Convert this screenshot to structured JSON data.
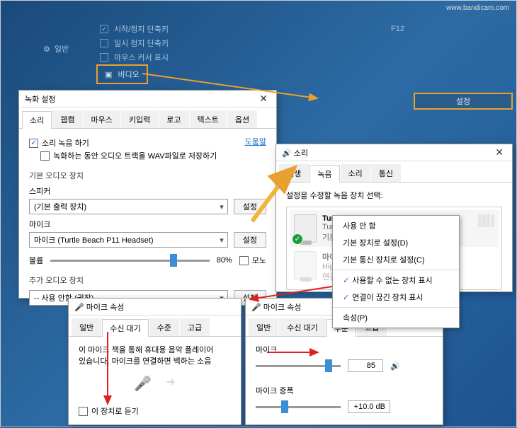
{
  "watermark": "www.bandicam.com",
  "bg": {
    "rows": [
      "시작/정지 단축키",
      "일시 정지 단축키",
      "마우스 커서 표시"
    ],
    "f12": "F12",
    "nav_general": "일반",
    "nav_video": "비디오",
    "setbtn": "설정"
  },
  "rec": {
    "title": "녹화 설정",
    "tabs": [
      "소리",
      "웹캠",
      "마우스",
      "키입력",
      "로고",
      "텍스트",
      "옵션"
    ],
    "opt1": "소리 녹음 하기",
    "opt2": "녹화하는 동안 오디오 트랙을 WAV파일로 저장하기",
    "help": "도움말",
    "group1": "기본 오디오 장치",
    "speaker_label": "스피커",
    "speaker_val": "(기본 출력 장치)",
    "mic_label": "마이크",
    "mic_val": "마이크 (Turtle Beach P11 Headset)",
    "btn_set": "설정",
    "volume": "볼륨",
    "volume_pct": "80%",
    "mono": "모노",
    "group2": "추가 오디오 장치",
    "extra_val": "-- 사용 안함 (권장) --"
  },
  "snd": {
    "title": "소리",
    "tabs": [
      "재생",
      "녹음",
      "소리",
      "통신"
    ],
    "desc": "설정을 수정할 녹음 장치 선택:",
    "dev1_name": "Turtle Beach P11",
    "dev1_line": "Turtle B",
    "dev1_sub": "기본 장",
    "dev2_name": "마이크",
    "dev2_line": "High D",
    "dev2_sub": "연결되"
  },
  "menu": {
    "items": [
      "사용 안 함",
      "기본 장치로 설정(D)",
      "기본 통신 장치로 설정(C)",
      "사용할 수 없는 장치 표시",
      "연결이 끊긴 장치 표시",
      "속성(P)"
    ]
  },
  "mic1": {
    "title": "마이크 속성",
    "tabs": [
      "일반",
      "수신 대기",
      "수준",
      "고급"
    ],
    "desc1": "이 마이크 잭을 통해 휴대용 음악 플레이어",
    "desc2": "있습니다. 마이크를 연결하면 백하는 소음",
    "listen": "이 장치로 듣기"
  },
  "mic2": {
    "title": "마이크 속성",
    "tabs": [
      "일반",
      "수신 대기",
      "수준",
      "고급"
    ],
    "mic_label": "마이크",
    "mic_val": "85",
    "boost_label": "마이크 증폭",
    "boost_val": "+10.0 dB"
  }
}
